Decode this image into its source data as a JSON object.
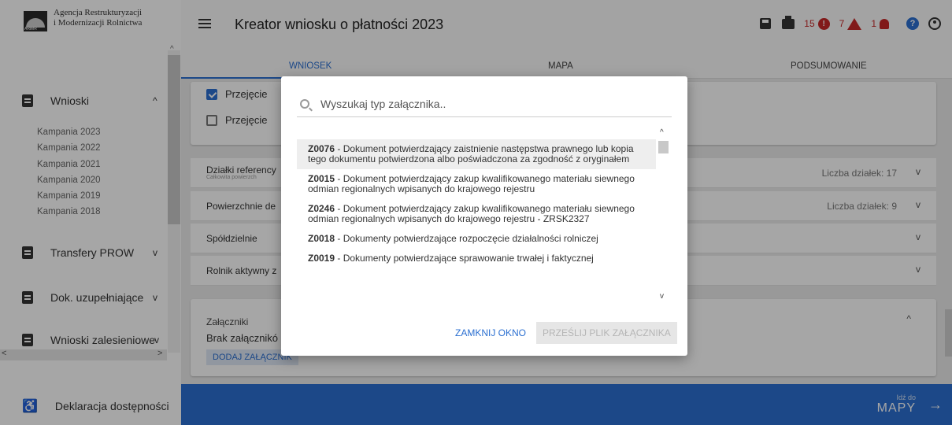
{
  "sidebar": {
    "logo_line1": "Agencja Restrukturyzacji",
    "logo_line2": "i Modernizacji Rolnictwa",
    "groups": [
      {
        "label": "Wnioski",
        "chevron": "^"
      },
      {
        "label": "Transfery PROW",
        "chevron": "v"
      },
      {
        "label": "Dok. uzupełniające",
        "chevron": "v"
      },
      {
        "label": "Wnioski zalesieniowe",
        "chevron": "v"
      }
    ],
    "campaigns": [
      "Kampania 2023",
      "Kampania 2022",
      "Kampania 2021",
      "Kampania 2020",
      "Kampania 2019",
      "Kampania 2018"
    ],
    "accessibility": "Deklaracja dostępności"
  },
  "header": {
    "title": "Kreator wniosku o płatności 2023",
    "errors": "15",
    "warnings": "7",
    "notifications": "1"
  },
  "tabs": [
    "WNIOSEK",
    "MAPA",
    "PODSUMOWANIE"
  ],
  "main": {
    "checkbox1": "Przejęcie",
    "checkbox2": "Przejęcie",
    "rows": [
      {
        "label": "Działki referency",
        "sub": "Całkowita powierzch",
        "right": "Liczba działek: 17"
      },
      {
        "label": "Powierzchnie de",
        "sub": "",
        "right": "Liczba działek: 9"
      },
      {
        "label": "Spółdzielnie",
        "sub": "",
        "right": ""
      },
      {
        "label": "Rolnik aktywny z",
        "sub": "",
        "right": ""
      }
    ],
    "attachments_title": "Załączniki",
    "attachments_none": "Brak załącznikó",
    "add_attachment": "DODAJ ZAŁĄCZNIK"
  },
  "bottom": {
    "goto_small": "Idź do",
    "goto_big": "MAPY"
  },
  "modal": {
    "search_placeholder": "Wyszukaj typ załącznika..",
    "items": [
      {
        "code": "Z0076",
        "text": " - Dokument potwierdzający zaistnienie następstwa prawnego lub kopia tego dokumentu potwierdzona albo poświadczona za zgodność z oryginałem"
      },
      {
        "code": "Z0015",
        "text": " - Dokument potwierdzający zakup kwalifikowanego materiału siewnego odmian regionalnych wpisanych do krajowego rejestru"
      },
      {
        "code": "Z0246",
        "text": " - Dokument potwierdzający zakup kwalifikowanego materiału siewnego odmian regionalnych wpisanych do krajowego rejestru - ZRSK2327"
      },
      {
        "code": "Z0018",
        "text": " - Dokumenty potwierdzające rozpoczęcie działalności rolniczej"
      },
      {
        "code": "Z0019",
        "text": " - Dokumenty potwierdzające sprawowanie trwałej i faktycznej"
      }
    ],
    "close_label": "ZAMKNIJ OKNO",
    "send_label": "PRZEŚLIJ PLIK ZAŁĄCZNIKA"
  }
}
